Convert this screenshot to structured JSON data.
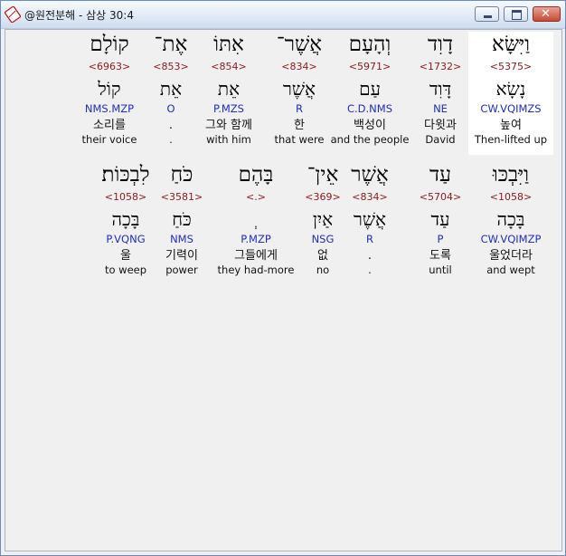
{
  "window": {
    "title": "@원전분해 - 삼상 30:4",
    "icon": "bible-book-icon"
  },
  "rows": [
    {
      "words": [
        {
          "hebrew": "וַיִּשָּׂא",
          "strong": "<5375>",
          "lemma": "נָשָׂא",
          "morph": "CW.VQIMZS",
          "korean": "높여",
          "english": "Then-lifted up",
          "selected": true
        },
        {
          "hebrew": "דָוִד",
          "strong": "<1732>",
          "lemma": "דָּוִד",
          "morph": "NE",
          "korean": "다윗과",
          "english": "David",
          "selected": false
        },
        {
          "hebrew": "וְהָעָם",
          "strong": "<5971>",
          "lemma": "עַם",
          "morph": "C.D.NMS",
          "korean": "백성이",
          "english": "and the people",
          "selected": false
        },
        {
          "hebrew": "אֲשֶׁר־",
          "strong": "<834>",
          "lemma": "אֲשֶׁר",
          "morph": "R",
          "korean": "한",
          "english": "that were",
          "selected": false
        },
        {
          "hebrew": "אִתּוֹ",
          "strong": "<854>",
          "lemma": "אֵת",
          "morph": "P.MZS",
          "korean": "그와 함께",
          "english": "with him",
          "selected": false
        },
        {
          "hebrew": "אֶת־",
          "strong": "<853>",
          "lemma": "אֵת",
          "morph": "O",
          "korean": ".",
          "english": ".",
          "selected": false
        },
        {
          "hebrew": "קוֹלָם",
          "strong": "<6963>",
          "lemma": "קוֹל",
          "morph": "NMS.MZP",
          "korean": "소리를",
          "english": "their voice",
          "selected": false
        }
      ]
    },
    {
      "words": [
        {
          "hebrew": "וַיִּבְכּוּ",
          "strong": "<1058>",
          "lemma": "בָּכָה",
          "morph": "CW.VQIMZP",
          "korean": "울었더라",
          "english": "and wept",
          "selected": false
        },
        {
          "hebrew": "עַד",
          "strong": "<5704>",
          "lemma": "עַד",
          "morph": "P",
          "korean": "도록",
          "english": "until",
          "selected": false
        },
        {
          "hebrew": "אֲשֶׁר",
          "strong": "<834>",
          "lemma": "אֲשֶׁר",
          "morph": "R",
          "korean": ".",
          "english": ".",
          "selected": false
        },
        {
          "hebrew": "אֵין־",
          "strong": "<369>",
          "lemma": "אַיִן",
          "morph": "NSG",
          "korean": "없",
          "english": "no",
          "selected": false
        },
        {
          "hebrew": "בָּהֶם",
          "strong": "<.>",
          "lemma": "ְ",
          "morph": "P.MZP",
          "korean": "그들에게",
          "english": "they had-more",
          "selected": false
        },
        {
          "hebrew": "כֹּחַ",
          "strong": "<3581>",
          "lemma": "כֹּחַ",
          "morph": "NMS",
          "korean": "기력이",
          "english": "power",
          "selected": false
        },
        {
          "hebrew": "לִבְכּוֹת׃",
          "strong": "<1058>",
          "lemma": "בָּכָה",
          "morph": "P.VQNG",
          "korean": "울",
          "english": "to weep",
          "selected": false
        }
      ]
    }
  ]
}
